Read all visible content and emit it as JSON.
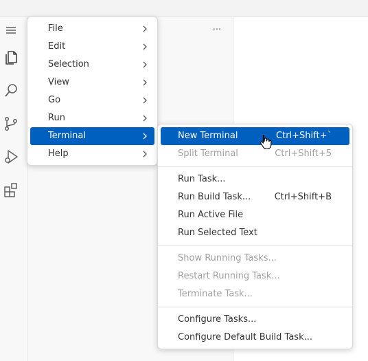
{
  "menubar_menu": {
    "items": [
      {
        "label": "File"
      },
      {
        "label": "Edit"
      },
      {
        "label": "Selection"
      },
      {
        "label": "View"
      },
      {
        "label": "Go"
      },
      {
        "label": "Run"
      },
      {
        "label": "Terminal",
        "active": true
      },
      {
        "label": "Help"
      }
    ]
  },
  "terminal_submenu": {
    "groups": [
      [
        {
          "label": "New Terminal",
          "shortcut": "Ctrl+Shift+`",
          "state": "highlighted"
        },
        {
          "label": "Split Terminal",
          "shortcut": "Ctrl+Shift+5",
          "state": "disabled"
        }
      ],
      [
        {
          "label": "Run Task...",
          "shortcut": ""
        },
        {
          "label": "Run Build Task...",
          "shortcut": "Ctrl+Shift+B"
        },
        {
          "label": "Run Active File",
          "shortcut": ""
        },
        {
          "label": "Run Selected Text",
          "shortcut": ""
        }
      ],
      [
        {
          "label": "Show Running Tasks...",
          "state": "disabled"
        },
        {
          "label": "Restart Running Task...",
          "state": "disabled"
        },
        {
          "label": "Terminate Task...",
          "state": "disabled"
        }
      ],
      [
        {
          "label": "Configure Tasks..."
        },
        {
          "label": "Configure Default Build Task..."
        }
      ]
    ]
  },
  "sidebar": {
    "more_actions_label": "···"
  },
  "icons": {
    "menu": "hamburger-menu-icon",
    "explorer": "files-icon",
    "search": "search-icon",
    "scm": "source-control-icon",
    "debug": "run-debug-icon",
    "extensions": "extensions-icon"
  },
  "colors": {
    "accent": "#0060c0",
    "disabled_text": "#a0a0a0"
  }
}
